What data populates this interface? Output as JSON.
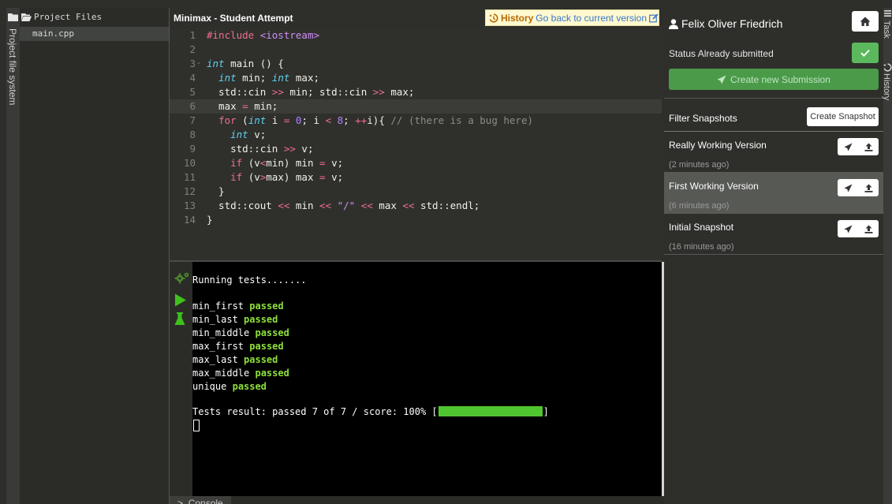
{
  "left_rail": {
    "label": "Project file system",
    "icon": "folder-icon"
  },
  "file_tree": {
    "header": "Project Files",
    "files": [
      {
        "name": "main.cpp"
      }
    ]
  },
  "editor": {
    "title": "Minimax - Student Attempt",
    "history_label": "History",
    "history_link": "Go back to current version",
    "active_line": 6,
    "lines": [
      {
        "n": "1",
        "tokens": [
          {
            "t": "#include ",
            "c": "inc"
          },
          {
            "t": "<iostream>",
            "c": "str"
          }
        ]
      },
      {
        "n": "2",
        "tokens": []
      },
      {
        "n": "3",
        "fold": true,
        "tokens": [
          {
            "t": "int",
            "c": "type"
          },
          {
            "t": " main () {",
            "c": "id"
          }
        ]
      },
      {
        "n": "4",
        "tokens": [
          {
            "t": "  ",
            "c": "id"
          },
          {
            "t": "int",
            "c": "type"
          },
          {
            "t": " min; ",
            "c": "id"
          },
          {
            "t": "int",
            "c": "type"
          },
          {
            "t": " max;",
            "c": "id"
          }
        ]
      },
      {
        "n": "5",
        "tokens": [
          {
            "t": "  std::cin ",
            "c": "id"
          },
          {
            "t": ">>",
            "c": "op"
          },
          {
            "t": " min; std::cin ",
            "c": "id"
          },
          {
            "t": ">>",
            "c": "op"
          },
          {
            "t": " max;",
            "c": "id"
          }
        ]
      },
      {
        "n": "6",
        "tokens": [
          {
            "t": "  max ",
            "c": "id"
          },
          {
            "t": "=",
            "c": "op"
          },
          {
            "t": " min;",
            "c": "id"
          }
        ]
      },
      {
        "n": "7",
        "tokens": [
          {
            "t": "  ",
            "c": "id"
          },
          {
            "t": "for",
            "c": "kw"
          },
          {
            "t": " (",
            "c": "id"
          },
          {
            "t": "int",
            "c": "type"
          },
          {
            "t": " i ",
            "c": "id"
          },
          {
            "t": "=",
            "c": "op"
          },
          {
            "t": " ",
            "c": "id"
          },
          {
            "t": "0",
            "c": "num"
          },
          {
            "t": "; i ",
            "c": "id"
          },
          {
            "t": "<",
            "c": "op"
          },
          {
            "t": " ",
            "c": "id"
          },
          {
            "t": "8",
            "c": "num"
          },
          {
            "t": "; ",
            "c": "id"
          },
          {
            "t": "++",
            "c": "op"
          },
          {
            "t": "i){ ",
            "c": "id"
          },
          {
            "t": "// (there is a bug here)",
            "c": "com"
          }
        ]
      },
      {
        "n": "8",
        "tokens": [
          {
            "t": "    ",
            "c": "id"
          },
          {
            "t": "int",
            "c": "type"
          },
          {
            "t": " v;",
            "c": "id"
          }
        ]
      },
      {
        "n": "9",
        "tokens": [
          {
            "t": "    std::cin ",
            "c": "id"
          },
          {
            "t": ">>",
            "c": "op"
          },
          {
            "t": " v;",
            "c": "id"
          }
        ]
      },
      {
        "n": "10",
        "tokens": [
          {
            "t": "    ",
            "c": "id"
          },
          {
            "t": "if",
            "c": "kw"
          },
          {
            "t": " (v",
            "c": "id"
          },
          {
            "t": "<",
            "c": "op"
          },
          {
            "t": "min) min ",
            "c": "id"
          },
          {
            "t": "=",
            "c": "op"
          },
          {
            "t": " v;",
            "c": "id"
          }
        ]
      },
      {
        "n": "11",
        "tokens": [
          {
            "t": "    ",
            "c": "id"
          },
          {
            "t": "if",
            "c": "kw"
          },
          {
            "t": " (v",
            "c": "id"
          },
          {
            "t": ">",
            "c": "op"
          },
          {
            "t": "max) max ",
            "c": "id"
          },
          {
            "t": "=",
            "c": "op"
          },
          {
            "t": " v;",
            "c": "id"
          }
        ]
      },
      {
        "n": "12",
        "tokens": [
          {
            "t": "  }",
            "c": "id"
          }
        ]
      },
      {
        "n": "13",
        "tokens": [
          {
            "t": "  std::cout ",
            "c": "id"
          },
          {
            "t": "<<",
            "c": "op"
          },
          {
            "t": " min ",
            "c": "id"
          },
          {
            "t": "<<",
            "c": "op"
          },
          {
            "t": " ",
            "c": "id"
          },
          {
            "t": "\"/\"",
            "c": "str"
          },
          {
            "t": " ",
            "c": "id"
          },
          {
            "t": "<<",
            "c": "op"
          },
          {
            "t": " max ",
            "c": "id"
          },
          {
            "t": "<<",
            "c": "op"
          },
          {
            "t": " std::endl;",
            "c": "id"
          }
        ]
      },
      {
        "n": "14",
        "tokens": [
          {
            "t": "}",
            "c": "id"
          }
        ]
      }
    ]
  },
  "console": {
    "running": "Running tests.......",
    "tests": [
      {
        "name": "min_first",
        "status": "passed"
      },
      {
        "name": "min_last",
        "status": "passed"
      },
      {
        "name": "min_middle",
        "status": "passed"
      },
      {
        "name": "max_first",
        "status": "passed"
      },
      {
        "name": "max_last",
        "status": "passed"
      },
      {
        "name": "max_middle",
        "status": "passed"
      },
      {
        "name": "unique",
        "status": "passed"
      }
    ],
    "result_prefix": "Tests result: passed 7 of 7 / score: 100% [",
    "result_suffix": "]",
    "progress": 1.0,
    "tab_label": "Console",
    "tab_chevron": ">"
  },
  "right_panel": {
    "user_name": "Felix Oliver Friedrich",
    "status_text": "Status Already submitted",
    "create_submission": "Create new Submission",
    "filter_label": "Filter Snapshots",
    "create_snapshot": "Create Snapshot",
    "snapshots": [
      {
        "name": "Really Working Version",
        "time": "(2 minutes ago)",
        "selected": false
      },
      {
        "name": "First Working Version",
        "time": "(6 minutes ago)",
        "selected": true
      },
      {
        "name": "Initial Snapshot",
        "time": "(16 minutes ago)",
        "selected": false
      }
    ]
  },
  "right_rail": {
    "tabs": [
      {
        "label": "Task",
        "icon": "list-icon"
      },
      {
        "label": "History",
        "icon": "history-icon"
      }
    ]
  },
  "colors": {
    "accent_green": "#5cb85c",
    "pass_green": "#8ee03a",
    "history_bg": "#fff8d0",
    "link_blue": "#3878c8"
  }
}
